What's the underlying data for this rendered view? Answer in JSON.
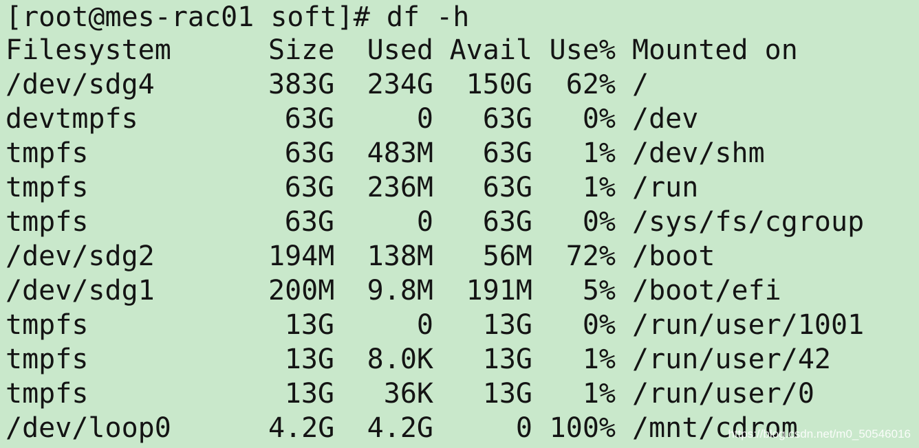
{
  "terminal": {
    "prompt": "[root@mes-rac01 soft]# ",
    "command": "df -h",
    "headers": {
      "filesystem": "Filesystem",
      "size": "Size",
      "used": "Used",
      "avail": "Avail",
      "use_pct": "Use%",
      "mounted_on": "Mounted on"
    },
    "rows": [
      {
        "filesystem": "/dev/sdg4",
        "size": "383G",
        "used": "234G",
        "avail": "150G",
        "use_pct": "62%",
        "mounted_on": "/"
      },
      {
        "filesystem": "devtmpfs",
        "size": "63G",
        "used": "0",
        "avail": "63G",
        "use_pct": "0%",
        "mounted_on": "/dev"
      },
      {
        "filesystem": "tmpfs",
        "size": "63G",
        "used": "483M",
        "avail": "63G",
        "use_pct": "1%",
        "mounted_on": "/dev/shm"
      },
      {
        "filesystem": "tmpfs",
        "size": "63G",
        "used": "236M",
        "avail": "63G",
        "use_pct": "1%",
        "mounted_on": "/run"
      },
      {
        "filesystem": "tmpfs",
        "size": "63G",
        "used": "0",
        "avail": "63G",
        "use_pct": "0%",
        "mounted_on": "/sys/fs/cgroup"
      },
      {
        "filesystem": "/dev/sdg2",
        "size": "194M",
        "used": "138M",
        "avail": "56M",
        "use_pct": "72%",
        "mounted_on": "/boot"
      },
      {
        "filesystem": "/dev/sdg1",
        "size": "200M",
        "used": "9.8M",
        "avail": "191M",
        "use_pct": "5%",
        "mounted_on": "/boot/efi"
      },
      {
        "filesystem": "tmpfs",
        "size": "13G",
        "used": "0",
        "avail": "13G",
        "use_pct": "0%",
        "mounted_on": "/run/user/1001"
      },
      {
        "filesystem": "tmpfs",
        "size": "13G",
        "used": "8.0K",
        "avail": "13G",
        "use_pct": "1%",
        "mounted_on": "/run/user/42"
      },
      {
        "filesystem": "tmpfs",
        "size": "13G",
        "used": "36K",
        "avail": "13G",
        "use_pct": "1%",
        "mounted_on": "/run/user/0"
      },
      {
        "filesystem": "/dev/loop0",
        "size": "4.2G",
        "used": "4.2G",
        "avail": "0",
        "use_pct": "100%",
        "mounted_on": "/mnt/cdrom"
      }
    ]
  },
  "watermark": "https://blog.csdn.net/m0_50546016",
  "colors": {
    "background": "#c9e8cb",
    "text": "#141414"
  }
}
